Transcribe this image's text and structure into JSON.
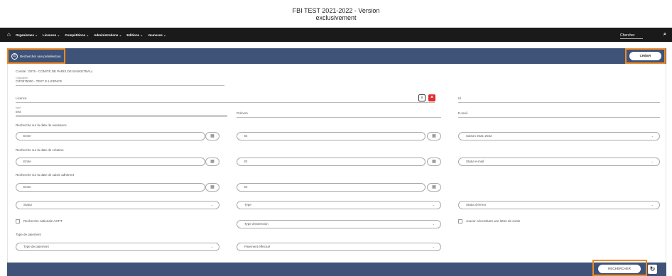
{
  "page": {
    "title_line1": "FBI TEST 2021-2022 - Version",
    "title_line2": "exclusivement"
  },
  "navbar": {
    "items": [
      "Organismes ⌄",
      "Licences ⌄",
      "Compétitions ⌄",
      "Administrations ⌄",
      "Editions ⌄",
      "Jeunesse ⌄"
    ],
    "search_label": "Chercher"
  },
  "header": {
    "preselection_label": "Rechercher une présélection",
    "create_label": "CRÉER"
  },
  "form": {
    "comite": "Comité : 0075 - COMITE DE PARIS DE BASKETBALL",
    "organisme_label": "Organisme",
    "organisme_value": "CIF0075000 - TEST E-LICENCE",
    "licence_label": "Licence",
    "id_label": "Id",
    "nom_label": "Nom",
    "nom_value": "test",
    "prenom_label": "Prénom",
    "email_label": "E-mail",
    "birth_section": "Recherche sur la date de naissance",
    "creation_section": "Recherche sur la date de création",
    "saisie_section": "Recherche sur la date de saisie adhérent",
    "entre": "Entre",
    "et": "Et",
    "saison_value": "Saison 2021-2022",
    "statut_email": "Statut e-mail",
    "statut": "Statut",
    "type": "Type",
    "statut_erreur": "Statut d'erreur",
    "recherche_nationale": "Recherche nationale ASTIT",
    "type_extension": "Type d'extension",
    "joueur_lettre": "Joueur nécessitant une lettre de sortie",
    "type_paiement_section": "Type de paiement",
    "type_paiement": "Type de paiement",
    "paiement_effectue": "Paiement effectué"
  },
  "footer": {
    "search_label": "RECHERCHER"
  }
}
